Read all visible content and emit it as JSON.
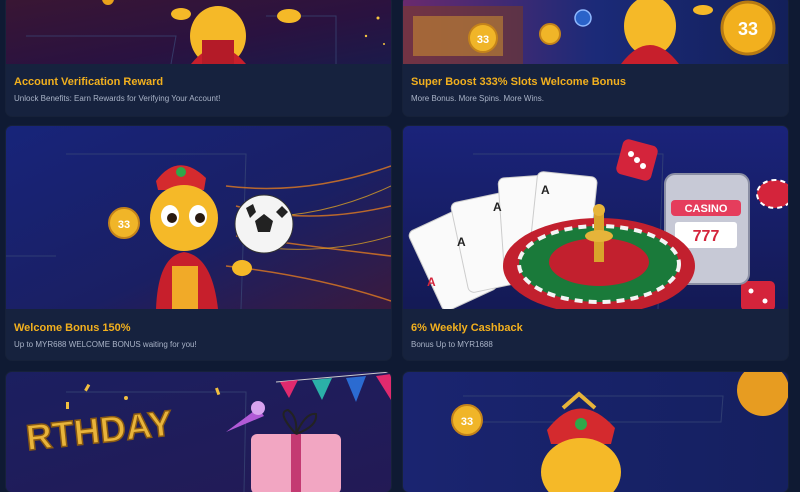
{
  "promotions": [
    {
      "title": "Account Verification Reward",
      "subtitle": "Unlock Benefits: Earn Rewards for Verifying Your Account!"
    },
    {
      "title": "Super Boost 333% Slots Welcome Bonus",
      "subtitle": "More Bonus. More Spins. More Wins."
    },
    {
      "title": "Welcome Bonus 150%",
      "subtitle": "Up to MYR688 WELCOME BONUS waiting for you!"
    },
    {
      "title": "6% Weekly Cashback",
      "subtitle": "Bonus Up to MYR1688"
    },
    {
      "title": "",
      "subtitle": ""
    },
    {
      "title": "",
      "subtitle": ""
    }
  ],
  "banner_text": {
    "coin_33": "33",
    "casino_sign": "CASINO",
    "slot_reels": "777",
    "birthday": "RTHDAY",
    "card_rank": "A"
  },
  "colors": {
    "page_bg": "#0f1a33",
    "card_bg": "#16223e",
    "title_gold": "#f2b01e",
    "subtitle_gray": "#a9b3c7"
  },
  "icons": [
    "mascot-genie-icon",
    "gold-coin-icon",
    "soccer-ball-icon",
    "dice-icon",
    "playing-cards-icon",
    "roulette-wheel-icon",
    "slot-machine-icon",
    "casino-chip-icon",
    "party-horn-icon",
    "gift-box-icon",
    "bunting-flags-icon"
  ]
}
